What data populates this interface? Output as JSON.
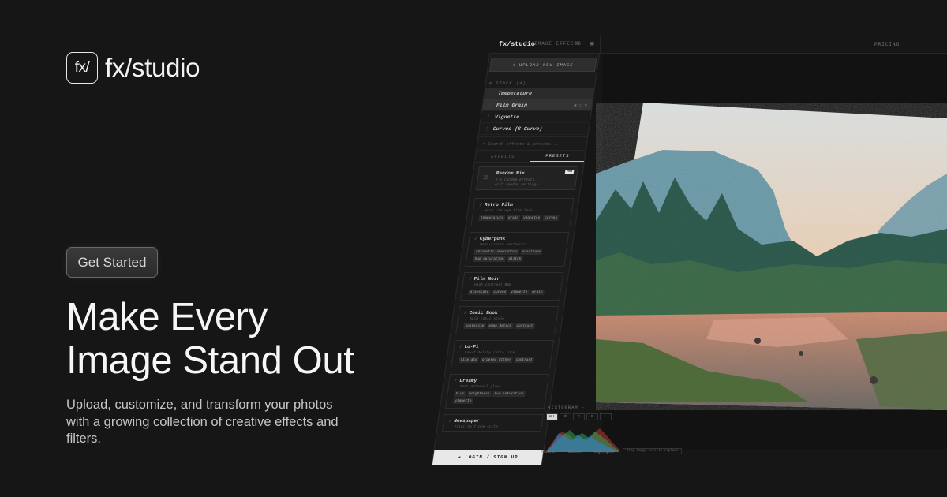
{
  "brand": {
    "logo_mark": "fx/",
    "name": "fx/studio"
  },
  "hero": {
    "cta_label": "Get Started",
    "headline_line1": "Make Every",
    "headline_line2": "Image Stand Out",
    "subtext": "Upload, customize, and transform your photos with a growing collection of creative effects and filters."
  },
  "app": {
    "topbar": {
      "logo": "fx/studio",
      "nav_label": "IMAGE EFFECTS",
      "pricing": "PRICING"
    },
    "sidebar": {
      "upload_label": "UPLOAD NEW IMAGE",
      "stack_label": "STACK (4)",
      "layers": [
        {
          "name": "Temperature"
        },
        {
          "name": "Film Grain"
        },
        {
          "name": "Vignette"
        },
        {
          "name": "Curves (S-Curve)"
        }
      ],
      "search_placeholder": "Search effects & presets...",
      "tabs": [
        "EFFECTS",
        "PRESETS"
      ],
      "random_mix": {
        "name": "Random Mix",
        "desc_line1": "2-4 random effects",
        "desc_line2": "with random settings",
        "badge": "PRO"
      },
      "presets": [
        {
          "name": "Retro Film",
          "desc": "Warm vintage film look",
          "chips": [
            "temperature",
            "grain",
            "vignette",
            "curves"
          ]
        },
        {
          "name": "Cyberpunk",
          "desc": "Neon-tinted aesthetic",
          "chips": [
            "chromatic aberration",
            "scanlines",
            "hue saturation",
            "glitch"
          ]
        },
        {
          "name": "Film Noir",
          "desc": "High contrast B&W",
          "chips": [
            "grayscale",
            "curves",
            "vignette",
            "grain"
          ]
        },
        {
          "name": "Comic Book",
          "desc": "Bold comic style",
          "chips": [
            "posterize",
            "edge detect",
            "contrast"
          ]
        },
        {
          "name": "Lo-Fi",
          "desc": "Low-fidelity retro look",
          "chips": [
            "pixelate",
            "ordered dither",
            "contrast"
          ]
        },
        {
          "name": "Dreamy",
          "desc": "Soft ethereal glow",
          "chips": [
            "blur",
            "brightness",
            "hue saturation",
            "vignette"
          ]
        },
        {
          "name": "Newspaper",
          "desc": "Print halftone style",
          "chips": []
        }
      ],
      "login_label": "LOGIN / SIGN UP"
    },
    "histogram": {
      "title": "HISTOGRAM -",
      "channels": [
        "ALL",
        "R",
        "G",
        "B",
        "L"
      ],
      "labels": [
        "Shadows",
        "Midtones",
        "Highlights"
      ]
    },
    "drop_hint": "Drop image here to replace"
  },
  "colors": {
    "background": "#161616",
    "text": "#f2f2f2",
    "accent": "#e8e8e8"
  },
  "icons": [
    "upload-icon",
    "layers-icon",
    "grip-icon",
    "search-icon",
    "shuffle-icon",
    "magic-wand-icon",
    "login-icon"
  ]
}
